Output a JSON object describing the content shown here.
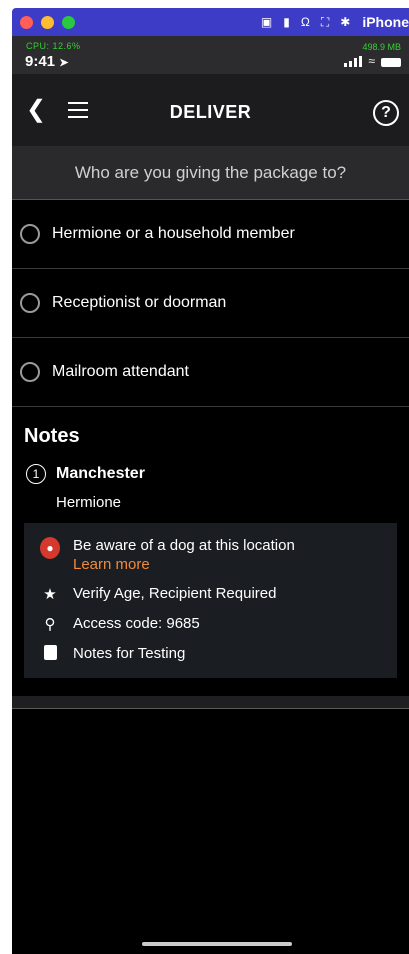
{
  "host": {
    "title": "iPhone",
    "dot_colors": [
      "#ff5f57",
      "#febc2e",
      "#28c840"
    ]
  },
  "status_bar": {
    "time": "9:41",
    "overlay_left": "CPU: 12.6%",
    "overlay_right": "498.9 MB"
  },
  "nav": {
    "title": "DELIVER",
    "help": "?"
  },
  "question": "Who are you giving the package to?",
  "options": [
    {
      "label": "Hermione or a household member"
    },
    {
      "label": "Receptionist or doorman"
    },
    {
      "label": "Mailroom attendant"
    }
  ],
  "notes": {
    "heading": "Notes",
    "stop_number": "1",
    "stop_name": "Manchester",
    "recipient": "Hermione",
    "warning": "Be aware of a dog at this location",
    "learn_more": "Learn more",
    "items": [
      {
        "icon": "star-icon",
        "text": "Verify Age, Recipient Required"
      },
      {
        "icon": "key-icon",
        "text": "Access code: 9685"
      },
      {
        "icon": "note-icon",
        "text": "Notes for Testing"
      }
    ]
  },
  "colors": {
    "accent": "#f08a3c",
    "warning": "#d5382d",
    "host_bar": "#3d3cc7"
  }
}
